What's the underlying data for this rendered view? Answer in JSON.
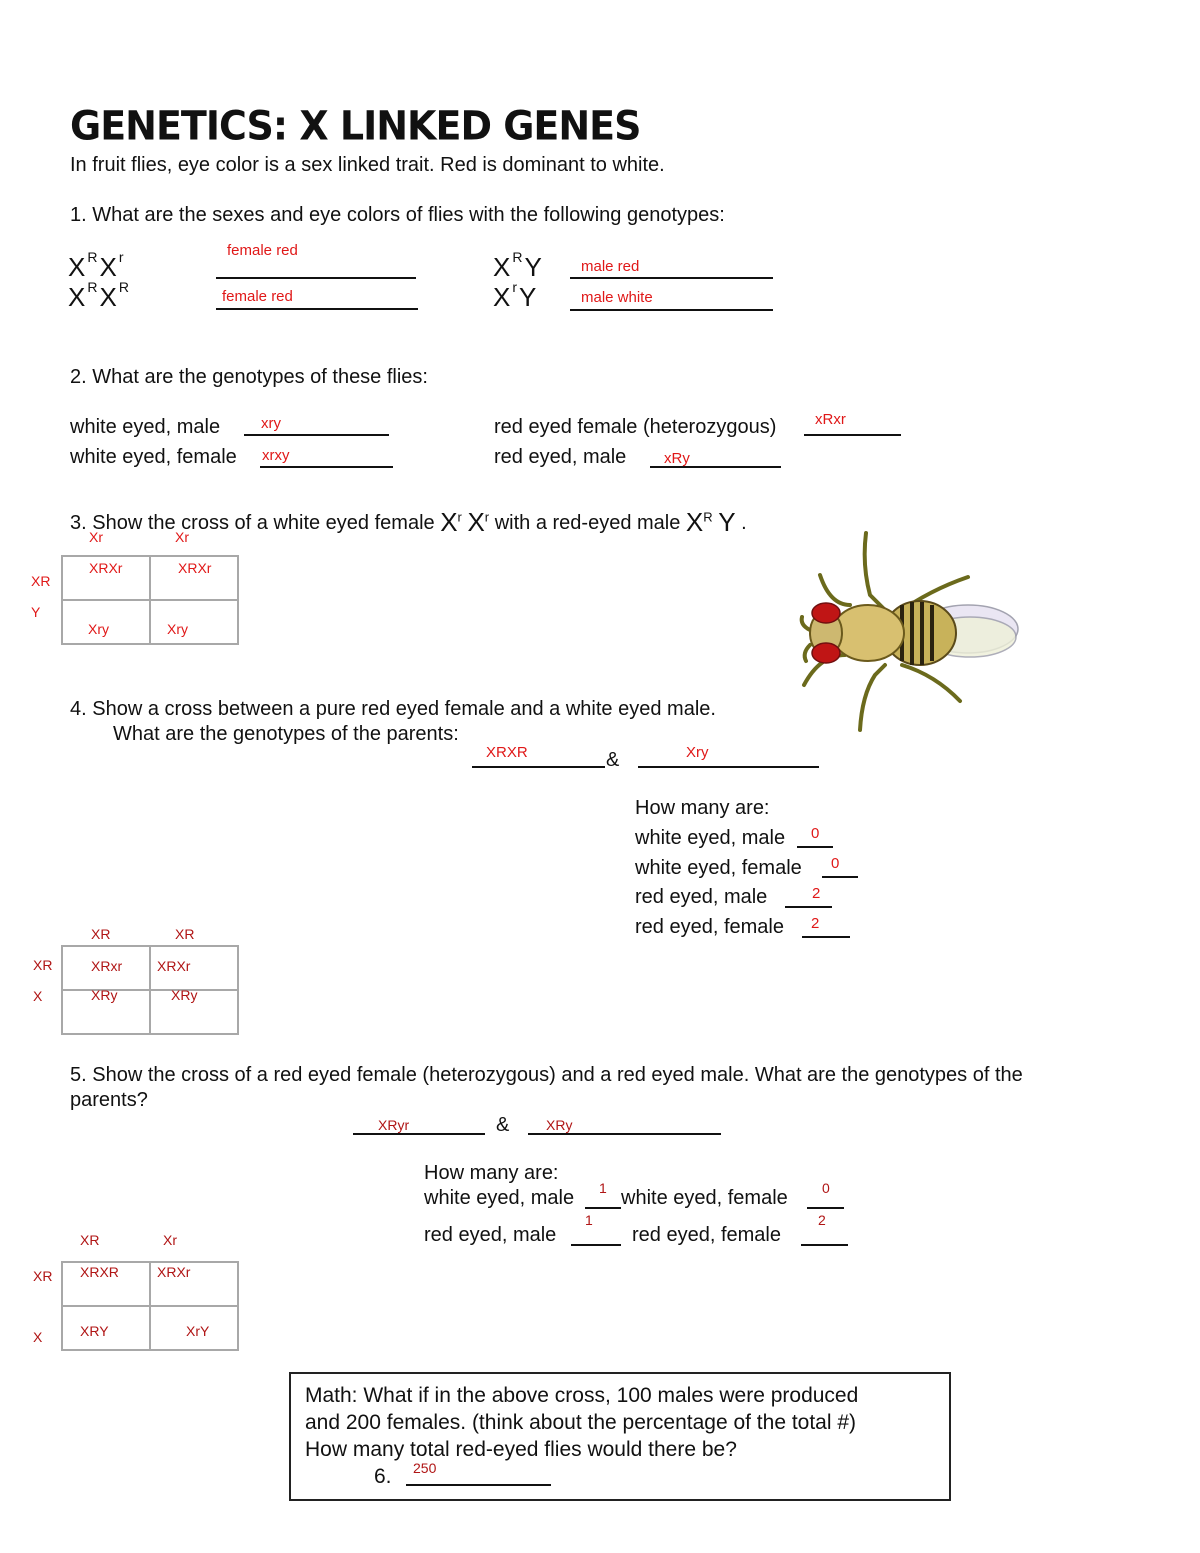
{
  "title": "GENETICS:  X LINKED GENES",
  "intro": "In fruit flies, eye color is a sex linked trait.  Red is dominant to white.",
  "q1": {
    "prompt": "1.  What are the sexes and eye colors of flies with the following genotypes:",
    "items": [
      {
        "X1": "X",
        "s1": "R",
        "X2": "X",
        "s2": "r",
        "answer": "female red"
      },
      {
        "X1": "X",
        "s1": "R",
        "X2": "X",
        "s2": "R",
        "answer": "female red"
      },
      {
        "X1": "X",
        "s1": "R",
        "X2": "Y",
        "answer": "male red"
      },
      {
        "X1": "X",
        "s1": "r",
        "X2": "Y",
        "answer": "male white"
      }
    ]
  },
  "q2": {
    "prompt": "2. What are the genotypes of these flies:",
    "items": [
      {
        "label": "white eyed, male",
        "answer": "xry"
      },
      {
        "label": "white eyed, female",
        "answer": "xrxy"
      },
      {
        "label": "red eyed female (heterozygous)",
        "answer": "xRxr"
      },
      {
        "label": "red eyed, male",
        "answer": "xRy"
      }
    ]
  },
  "q3": {
    "prompt_a": "3.  Show the cross of a white eyed female",
    "g1": "X",
    "g1s": "r",
    "g2": "X",
    "g2s": "r",
    "prompt_b": "with a red-eyed male",
    "g3": "X",
    "g3s": "R",
    "g4": "Y",
    "end": ".",
    "punnett": {
      "top": [
        "Xr",
        "Xr"
      ],
      "side": [
        "XR",
        "Y"
      ],
      "cells": [
        [
          "XRXr",
          "XRXr"
        ],
        [
          "Xry",
          "Xry"
        ]
      ]
    }
  },
  "q4": {
    "prompt1": "4.   Show a cross between a pure red eyed female and a white eyed male.",
    "prompt2": "What are the genotypes of the parents:",
    "parent1": "XRXR",
    "amp": "&",
    "parent2": "Xry",
    "how_many": "How many are:",
    "counts": [
      {
        "label": "white eyed, male",
        "value": "0"
      },
      {
        "label": "white eyed, female",
        "value": "0"
      },
      {
        "label": "red eyed, male",
        "value": "2"
      },
      {
        "label": "red eyed, female",
        "value": "2"
      }
    ],
    "punnett": {
      "top": [
        "XR",
        "XR"
      ],
      "side": [
        "XR",
        "X"
      ],
      "cells": [
        [
          "XRxr",
          "XRXr"
        ],
        [
          "XRy",
          "XRy"
        ]
      ]
    }
  },
  "q5": {
    "prompt1": "5.  Show the cross of a red eyed female (heterozygous) and a red eyed male.  What are the genotypes of the",
    "prompt2": "parents?",
    "parent1": "XRyr",
    "amp": "&",
    "parent2": "XRy",
    "how_many": "How many are:",
    "counts": [
      {
        "label": "white eyed, male",
        "value": "1"
      },
      {
        "label": "white eyed, female",
        "value": "0"
      },
      {
        "label": "red eyed, male",
        "value": "1"
      },
      {
        "label": "red eyed, female",
        "value": "2"
      }
    ],
    "punnett": {
      "top": [
        "XR",
        "Xr"
      ],
      "side": [
        "XR",
        "X"
      ],
      "cells": [
        [
          "XRXR",
          "XRXr"
        ],
        [
          "XRY",
          "XrY"
        ]
      ]
    }
  },
  "math": {
    "line1": "Math:   What if in the above cross, 100 males were produced",
    "line2": "and 200 females. (think about the percentage of the total #)",
    "line3": "How many total red-eyed flies would there be?",
    "num": "6.",
    "answer": "250"
  },
  "image": {
    "icon": "fruit-fly-illustration"
  }
}
